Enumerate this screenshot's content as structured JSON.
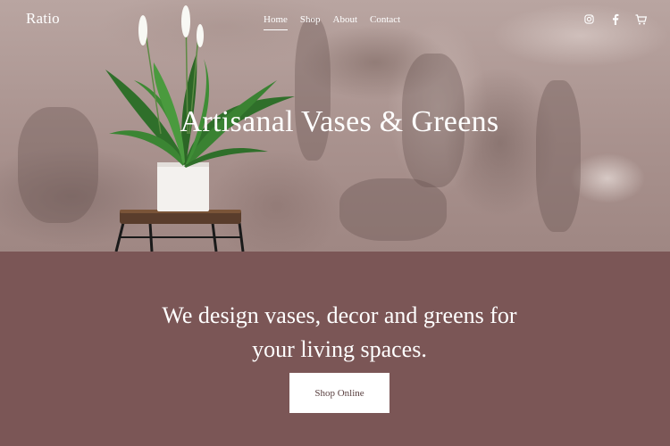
{
  "brand": {
    "logo": "Ratio"
  },
  "nav": {
    "links": [
      {
        "label": "Home",
        "active": true
      },
      {
        "label": "Shop"
      },
      {
        "label": "About"
      },
      {
        "label": "Contact"
      }
    ],
    "icons": [
      "instagram-icon",
      "facebook-icon",
      "cart-icon"
    ]
  },
  "hero": {
    "title": "Artisanal Vases & Greens"
  },
  "intro": {
    "line1": "We design vases, decor and greens for",
    "line2": "your living spaces.",
    "cta_label": "Shop Online"
  },
  "colors": {
    "section_bg": "#7b5656",
    "text": "#ffffff",
    "button_bg": "#ffffff"
  }
}
